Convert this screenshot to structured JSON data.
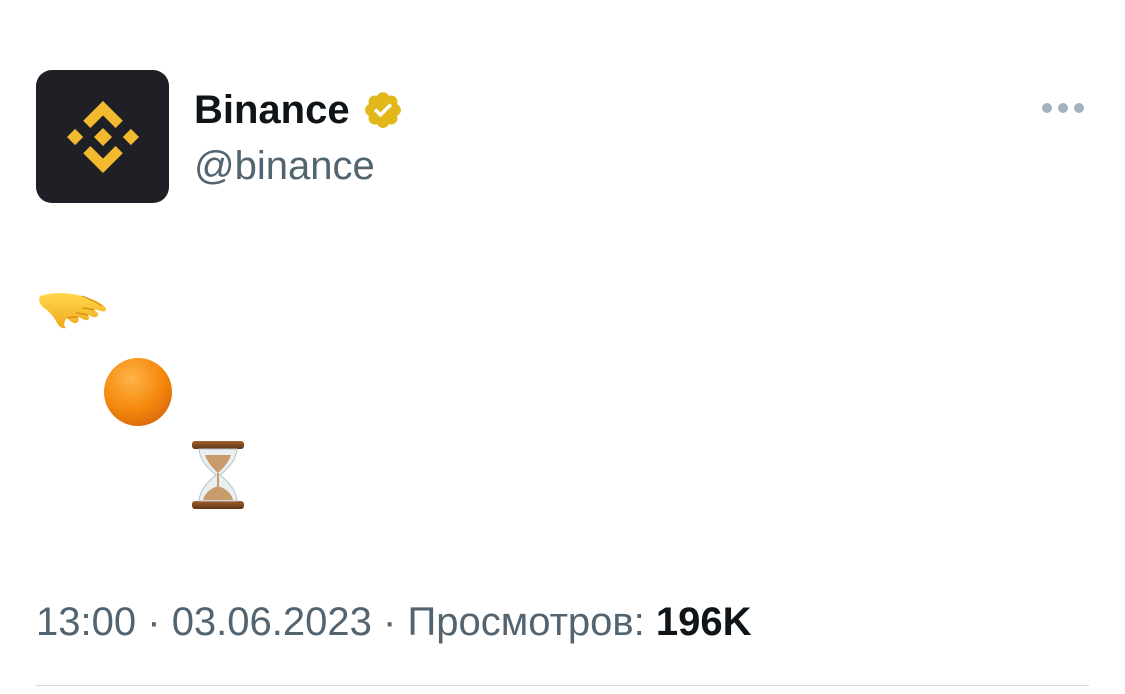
{
  "author": {
    "display_name": "Binance",
    "handle": "@binance",
    "verified": true
  },
  "tweet": {
    "emojis": [
      "hand-pointing-down-emoji",
      "orange-circle-emoji",
      "hourglass-emoji"
    ],
    "time": "13:00",
    "separator": "·",
    "date": "03.06.2023",
    "views_label": "Просмотров:",
    "views_count": "196K"
  },
  "colors": {
    "brand": "#F3BA2F",
    "avatar_bg": "#1E2026",
    "verified_badge": "#E2B719",
    "text_primary": "#0F1419",
    "text_secondary": "#536471"
  }
}
